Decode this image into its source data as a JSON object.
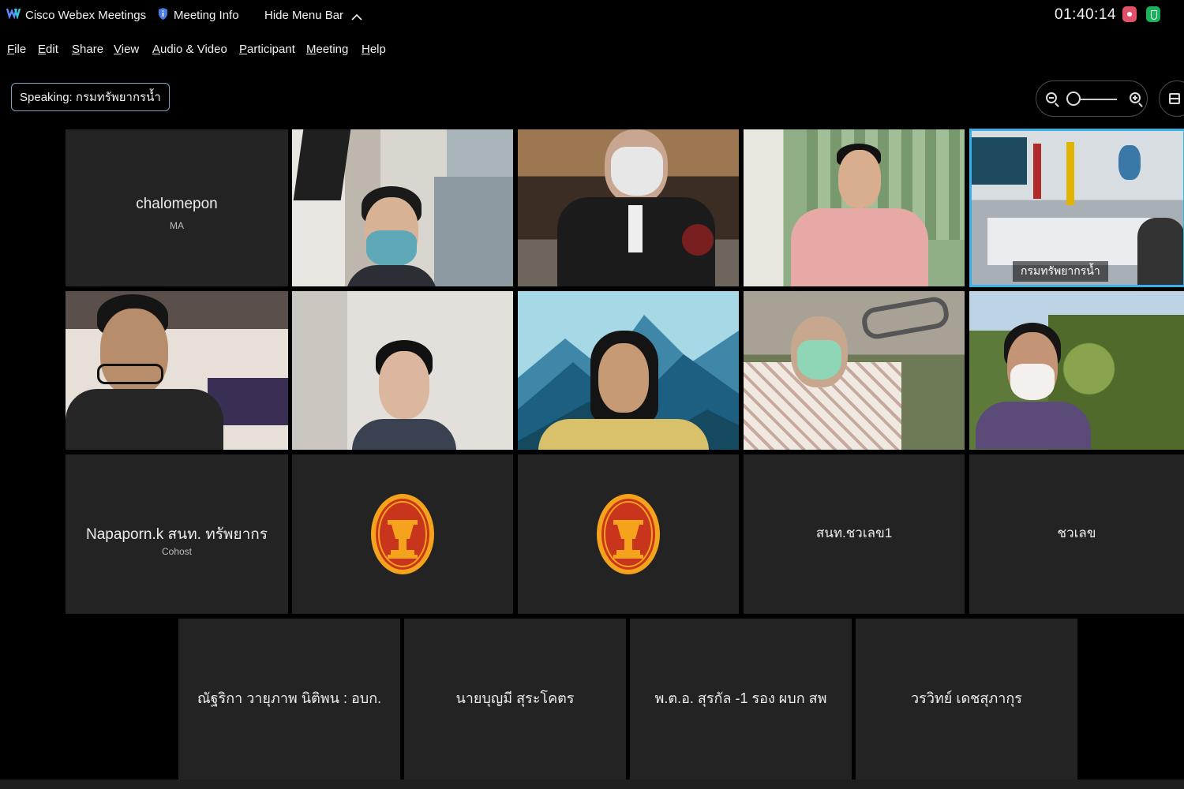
{
  "titlebar": {
    "app_name": "Cisco Webex Meetings",
    "meeting_info": "Meeting Info",
    "hide_menu": "Hide Menu Bar",
    "timer": "01:40:14"
  },
  "menu": [
    "File",
    "Edit",
    "Share",
    "View",
    "Audio & Video",
    "Participant",
    "Meeting",
    "Help"
  ],
  "speaking": {
    "label": "Speaking: กรมทรัพยากรน้ำ"
  },
  "colors": {
    "accent": "#3ab0e8",
    "tile_bg": "#232323",
    "record": "#e2506a",
    "secure": "#18b35a"
  },
  "tiles": {
    "t1": {
      "name": "chalomepon",
      "role": "MA"
    },
    "t5": {
      "caption": "กรมทรัพยากรน้ำ"
    },
    "t11": {
      "name": "Napaporn.k สนท. ทรัพยากร",
      "role": "Cohost"
    },
    "t14": {
      "name": "สนท.ชวเลข1"
    },
    "t15": {
      "name": "ชวเลข"
    },
    "t16": {
      "name": "ณัฐริกา วายุภาพ นิติพน : อบก."
    },
    "t17": {
      "name": "นายบุญมี สุระโคตร"
    },
    "t18": {
      "name": "พ.ต.อ. สุรกัล -1 รอง ผบก สพ"
    },
    "t19": {
      "name": "วรวิทย์ เดชสุภากุร"
    }
  }
}
